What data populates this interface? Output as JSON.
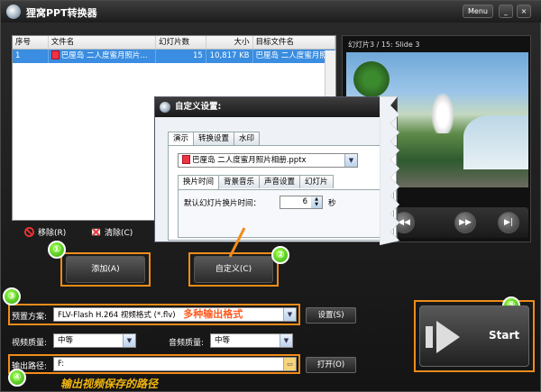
{
  "window": {
    "title": "狸窝PPT转换器",
    "menu_label": "Menu",
    "minimize_label": "_",
    "close_label": "×"
  },
  "file_list": {
    "columns": [
      "序号",
      "文件名",
      "幻灯片数",
      "大小",
      "目标文件名"
    ],
    "rows": [
      {
        "index": "1",
        "name": "巴厘岛 二人度蜜月照片...",
        "slides": "15",
        "size": "10,817 KB",
        "target": "巴厘岛 二人度蜜月照片..."
      }
    ]
  },
  "preview": {
    "label": "幻灯片3 / 15: Slide 3",
    "prev_label": "◀◀",
    "next_label": "▶▶",
    "end_label": "▶|"
  },
  "list_actions": {
    "remove_label": "移除(R)",
    "clear_label": "清除(C)"
  },
  "buttons": {
    "add_label": "添加(A)",
    "custom_label": "自定义(C)",
    "settings_label": "设置(S)",
    "open_label": "打开(O)",
    "start_label": "Start"
  },
  "badges": [
    "①",
    "②",
    "③",
    "④",
    "⑤"
  ],
  "preset": {
    "label": "预置方案:",
    "value": "FLV-Flash H.264 视频格式 (*.flv)",
    "annotation": "多种输出格式"
  },
  "video_quality": {
    "label": "视频质量:",
    "value": "中等"
  },
  "audio_quality": {
    "label": "音频质量:",
    "value": "中等"
  },
  "output": {
    "label": "输出路径:",
    "value": "F:",
    "annotation": "输出视频保存的路径"
  },
  "dialog": {
    "title": "自定义设置:",
    "tabs": [
      "演示",
      "转换设置",
      "水印"
    ],
    "file_value": "巴厘岛 二人度蜜月照片相册.pptx",
    "inner_tabs": [
      "换片时间",
      "背景音乐",
      "声音设置",
      "幻灯片"
    ],
    "interval_label": "默认幻灯片换片时间：",
    "interval_value": "6",
    "interval_unit": "秒"
  },
  "colors": {
    "accent_orange": "#f08c1a",
    "selected_row": "#3a8de0",
    "annotation_red": "#ff5a1f",
    "annotation_gold": "#f3b70d"
  }
}
